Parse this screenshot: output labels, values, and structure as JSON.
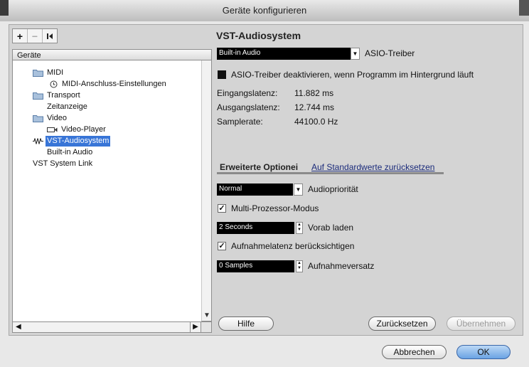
{
  "window": {
    "title": "Geräte konfigurieren"
  },
  "left": {
    "toolbar": {
      "add": "+",
      "remove": "−",
      "reset": "I◂"
    },
    "tree_header": "Geräte",
    "tree": {
      "midi": "MIDI",
      "midi_settings": "MIDI-Anschluss-Einstellungen",
      "transport": "Transport",
      "time_display": "Zeitanzeige",
      "video": "Video",
      "video_player": "Video-Player",
      "vst_audio": "VST-Audiosystem",
      "builtin_audio": "Built-in Audio",
      "vst_system_link": "VST System Link"
    }
  },
  "right": {
    "heading": "VST-Audiosystem",
    "driver": {
      "value": "Built-in Audio",
      "label": "ASIO-Treiber"
    },
    "deactivate": {
      "label": "ASIO-Treiber deaktivieren, wenn Programm im Hintergrund läuft"
    },
    "info": {
      "input_label": "Eingangslatenz:",
      "input_value": "11.882 ms",
      "output_label": "Ausgangslatenz:",
      "output_value": "12.744 ms",
      "rate_label": "Samplerate:",
      "rate_value": "44100.0 Hz"
    },
    "tabs": {
      "advanced": "Erweiterte Optionei",
      "reset_link": "Auf Standardwerte zurücksetzen"
    },
    "priority": {
      "value": "Normal",
      "label": "Audiopriorität"
    },
    "multiproc": {
      "label": "Multi-Prozessor-Modus",
      "checked": true
    },
    "preload": {
      "value": "2 Seconds",
      "label": "Vorab laden"
    },
    "rec_latency": {
      "label": "Aufnahmelatenz berücksichtigen",
      "checked": true
    },
    "rec_offset": {
      "value": "0 Samples",
      "label": "Aufnahmeversatz"
    },
    "buttons": {
      "help": "Hilfe",
      "reset": "Zurücksetzen",
      "apply": "Übernehmen"
    }
  },
  "footer": {
    "cancel": "Abbrechen",
    "ok": "OK"
  }
}
